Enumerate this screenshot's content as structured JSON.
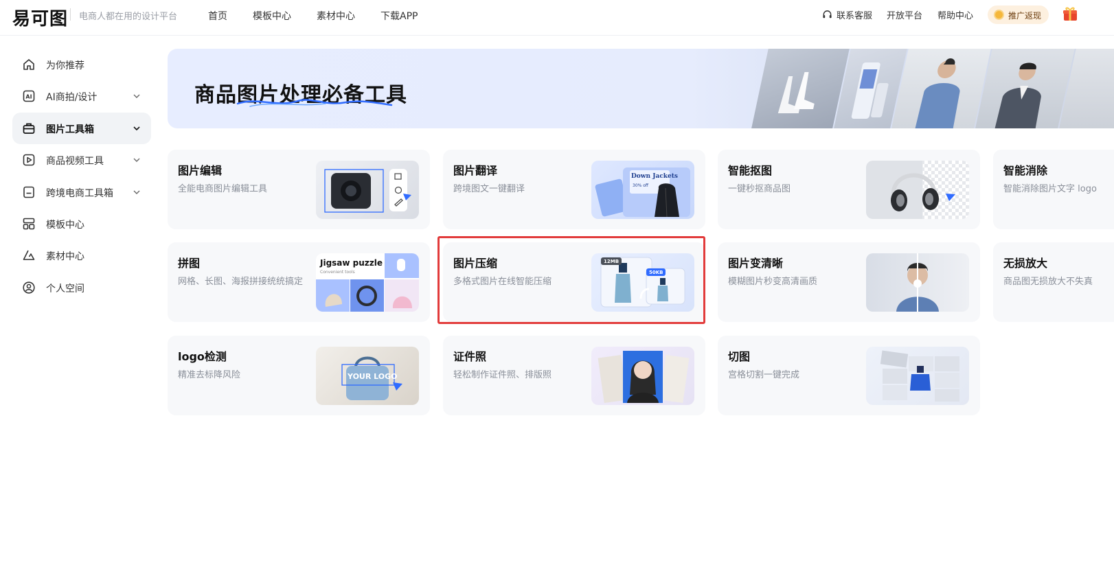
{
  "header": {
    "logo": "易可图",
    "tagline": "电商人都在用的设计平台",
    "nav": [
      "首页",
      "模板中心",
      "素材中心",
      "下载APP"
    ],
    "right": {
      "service": "联系客服",
      "open_platform": "开放平台",
      "help": "帮助中心",
      "promo": "推广返现"
    }
  },
  "sidebar": {
    "items": [
      {
        "label": "为你推荐",
        "icon": "home-icon",
        "has_arrow": false
      },
      {
        "label": "AI商拍/设计",
        "icon": "ai-icon",
        "has_arrow": true
      },
      {
        "label": "图片工具箱",
        "icon": "toolbox-icon",
        "has_arrow": true,
        "active": true
      },
      {
        "label": "商品视频工具",
        "icon": "video-icon",
        "has_arrow": true
      },
      {
        "label": "跨境电商工具箱",
        "icon": "cross-border-icon",
        "has_arrow": true
      },
      {
        "label": "模板中心",
        "icon": "template-icon",
        "has_arrow": false
      },
      {
        "label": "素材中心",
        "icon": "material-icon",
        "has_arrow": false
      },
      {
        "label": "个人空间",
        "icon": "user-icon",
        "has_arrow": false
      }
    ]
  },
  "banner": {
    "title": "商品图片处理必备工具"
  },
  "tools": [
    {
      "title": "图片编辑",
      "desc": "全能电商图片编辑工具"
    },
    {
      "title": "图片翻译",
      "desc": "跨境图文一键翻译",
      "thumb_text": "Down Jackets",
      "thumb_sub": "30% off"
    },
    {
      "title": "智能抠图",
      "desc": "一键秒抠商品图"
    },
    {
      "title": "智能消除",
      "desc": "智能消除图片文字 logo"
    },
    {
      "title": "拼图",
      "desc": "网格、长图、海报拼接统统搞定",
      "thumb_text": "Jigsaw puzzle",
      "thumb_sub": "Convenient tools"
    },
    {
      "title": "图片压缩",
      "desc": "多格式图片在线智能压缩",
      "thumb_text": "12MB",
      "thumb_sub": "50KB"
    },
    {
      "title": "图片变清晰",
      "desc": "模糊图片秒变高清画质"
    },
    {
      "title": "无损放大",
      "desc": "商品图无损放大不失真"
    },
    {
      "title": "logo检测",
      "desc": "精准去标降风险",
      "thumb_text": "YOUR LOGO"
    },
    {
      "title": "证件照",
      "desc": "轻松制作证件照、排版照"
    },
    {
      "title": "切图",
      "desc": "宫格切割一键完成"
    }
  ],
  "colors": {
    "accent": "#2f6bff",
    "highlight": "#e23b3b",
    "promo_bg": "#fdf0df"
  }
}
